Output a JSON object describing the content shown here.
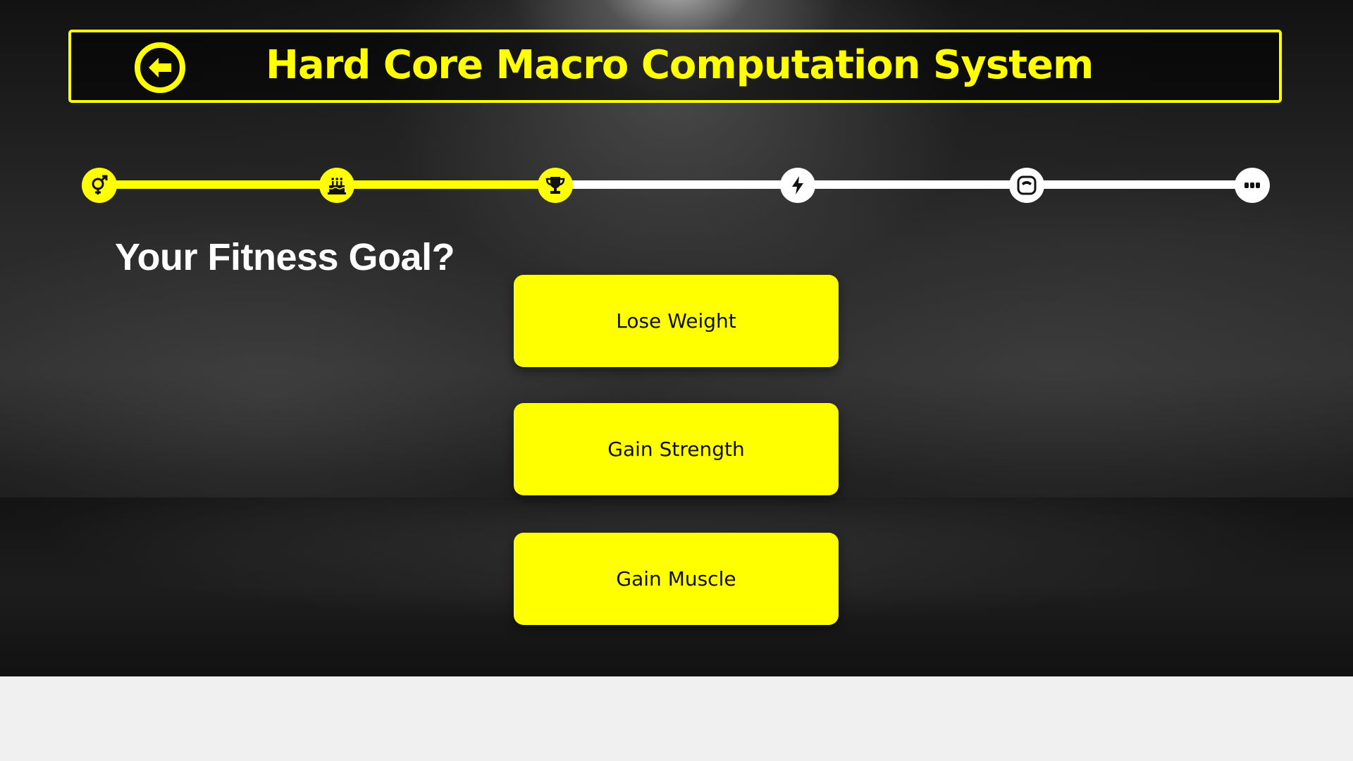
{
  "header": {
    "title": "Hard Core Macro Computation System",
    "back_icon": "arrow-left-circle-icon"
  },
  "stepper": {
    "total_steps": 6,
    "completed_steps": 3,
    "steps": [
      {
        "icon": "gender-icon",
        "state": "done"
      },
      {
        "icon": "birthday-cake-icon",
        "state": "done"
      },
      {
        "icon": "trophy-icon",
        "state": "done"
      },
      {
        "icon": "lightning-bolt-icon",
        "state": "todo"
      },
      {
        "icon": "scale-icon",
        "state": "todo"
      },
      {
        "icon": "more-dots-icon",
        "state": "todo"
      }
    ]
  },
  "question": "Your Fitness Goal?",
  "options": [
    {
      "label": "Lose Weight"
    },
    {
      "label": "Gain Strength"
    },
    {
      "label": "Gain Muscle"
    }
  ],
  "colors": {
    "accent": "#ffff00",
    "inactive": "#ffffff",
    "background": "#1c1c1c",
    "page": "#f0f0f0"
  }
}
